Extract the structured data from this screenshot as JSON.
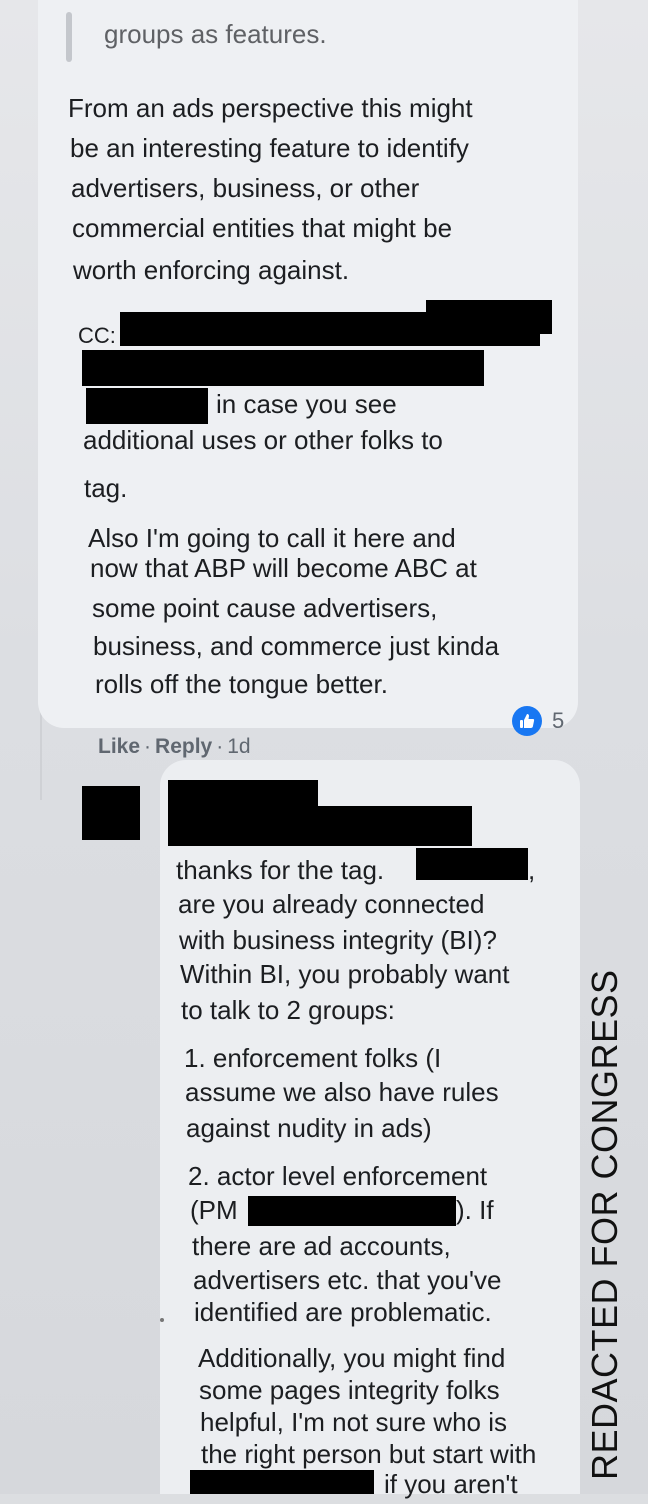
{
  "comment1": {
    "quote_text": "groups as features.",
    "paragraph1": [
      "From an ads perspective this might",
      "be an interesting feature to identify",
      "advertisers, business, or other",
      "commercial entities that might be",
      "worth enforcing against."
    ],
    "cc_label": "CC:",
    "cc_tail": "in case you see",
    "cc_lines": [
      "additional uses or other folks to",
      "tag."
    ],
    "paragraph2": [
      "Also I'm going to call it here and",
      "now that ABP will become ABC at",
      "some point cause advertisers,",
      "business, and commerce just kinda",
      "rolls off the tongue better."
    ],
    "reaction_count": "5",
    "actions": {
      "like": "Like",
      "reply": "Reply",
      "time": "1d"
    }
  },
  "comment2": {
    "line1": "thanks for the tag.",
    "line1_tail": ",",
    "intro": [
      "are you already connected",
      "with business integrity (BI)?",
      "Within BI, you probably want",
      "to talk to 2 groups:"
    ],
    "item1": [
      "1. enforcement folks (I",
      "assume we also have rules",
      "against nudity in ads)"
    ],
    "item2_line1": "2. actor level enforcement",
    "item2_pm_prefix": "(PM",
    "item2_pm_suffix": "). If",
    "item2_rest": [
      "there are ad accounts,",
      "advertisers etc. that you've",
      "identified are problematic."
    ],
    "additional": [
      "Additionally, you might find",
      "some pages integrity folks",
      "helpful, I'm not sure who is",
      "the right person but start with"
    ],
    "last_line_tail": "if you aren't"
  },
  "watermark": "REDACTED FOR CONGRESS",
  "colors": {
    "reaction_blue": "#1877f2",
    "redaction": "#000000"
  },
  "icons": {
    "reaction": "thumbs-up-icon"
  }
}
